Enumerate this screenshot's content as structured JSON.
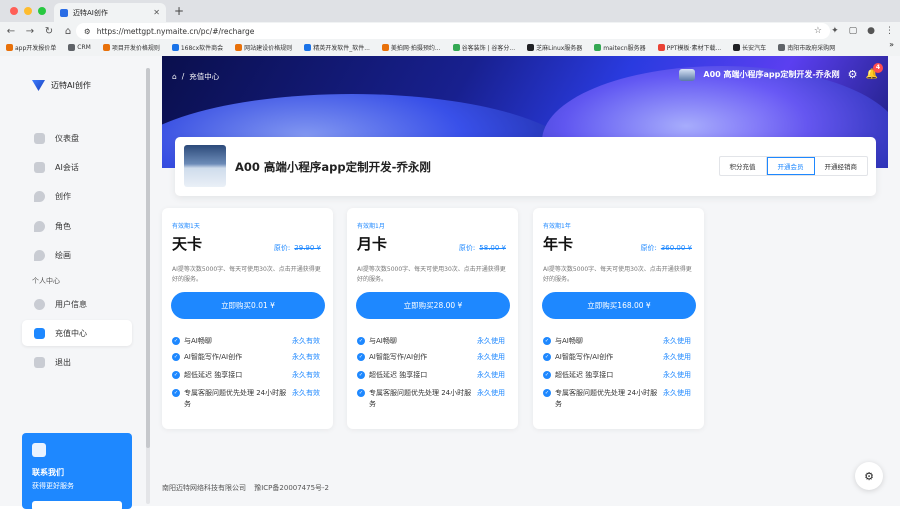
{
  "browser": {
    "tab_title": "迈特AI创作",
    "url": "https://mettgpt.nymaite.cn/pc/#/recharge",
    "bookmarks": [
      "app开发报价单",
      "CRM",
      "项目开发价格规则",
      "168cx软件商会",
      "网站建设价格规则",
      "精英开发软件_软件...",
      "美拍网·拍摄预约...",
      "谷客装饰 | 谷客分...",
      "芝麻Linux服务器",
      "maitecn服务器",
      "PPT模板·素材下载...",
      "长安汽车",
      "南阳市政府采购网"
    ]
  },
  "sidebar": {
    "logo": "迈特AI创作",
    "items": [
      {
        "label": "仪表盘"
      },
      {
        "label": "AI会话"
      },
      {
        "label": "创作"
      },
      {
        "label": "角色"
      },
      {
        "label": "绘画"
      }
    ],
    "section": "个人中心",
    "items2": [
      {
        "label": "用户信息"
      },
      {
        "label": "充值中心"
      },
      {
        "label": "退出"
      }
    ],
    "contact": {
      "title": "联系我们",
      "subtitle": "获得更好服务"
    }
  },
  "header": {
    "breadcrumb": "充值中心",
    "username": "A00 高端小程序app定制开发-乔永刚",
    "badge": "4"
  },
  "profile": {
    "name": "A00 高端小程序app定制开发-乔永刚",
    "tabs": [
      "积分充值",
      "开通会员",
      "开通经销商"
    ]
  },
  "plans": [
    {
      "period": "有效期1天",
      "name": "天卡",
      "orig_label": "原价:",
      "orig_price": "29.90 ¥",
      "desc": "AI提等次数5000字、每天可使用30次、点击开通获得更好的服务。",
      "button": "立即购买0.01 ¥",
      "features": [
        [
          "与AI畅聊",
          "永久有效"
        ],
        [
          "AI智能写作/AI创作",
          "永久有效"
        ],
        [
          "超低延迟 独享接口",
          "永久有效"
        ],
        [
          "专属客服问题优先处理 24小时服务",
          "永久有效"
        ]
      ]
    },
    {
      "period": "有效期1月",
      "name": "月卡",
      "orig_label": "原价:",
      "orig_price": "58.00 ¥",
      "desc": "AI提等次数5000字、每天可使用30次、点击开通获得更好的服务。",
      "button": "立即购买28.00 ¥",
      "features": [
        [
          "与AI畅聊",
          "永久使用"
        ],
        [
          "AI智能写作/AI创作",
          "永久使用"
        ],
        [
          "超低延迟 独享接口",
          "永久使用"
        ],
        [
          "专属客服问题优先处理 24小时服务",
          "永久使用"
        ]
      ]
    },
    {
      "period": "有效期1年",
      "name": "年卡",
      "orig_label": "原价:",
      "orig_price": "360.00 ¥",
      "desc": "AI提等次数5000字、每天可使用30次、点击开通获得更好的服务。",
      "button": "立即购买168.00 ¥",
      "features": [
        [
          "与AI畅聊",
          "永久使用"
        ],
        [
          "AI智能写作/AI创作",
          "永久使用"
        ],
        [
          "超低延迟 独享接口",
          "永久使用"
        ],
        [
          "专属客服问题优先处理 24小时服务",
          "永久使用"
        ]
      ]
    }
  ],
  "footer": {
    "company": "南阳迈特网络科技有限公司",
    "icp": "豫ICP备20007475号-2"
  },
  "colors": {
    "accent": "#1e88ff"
  }
}
